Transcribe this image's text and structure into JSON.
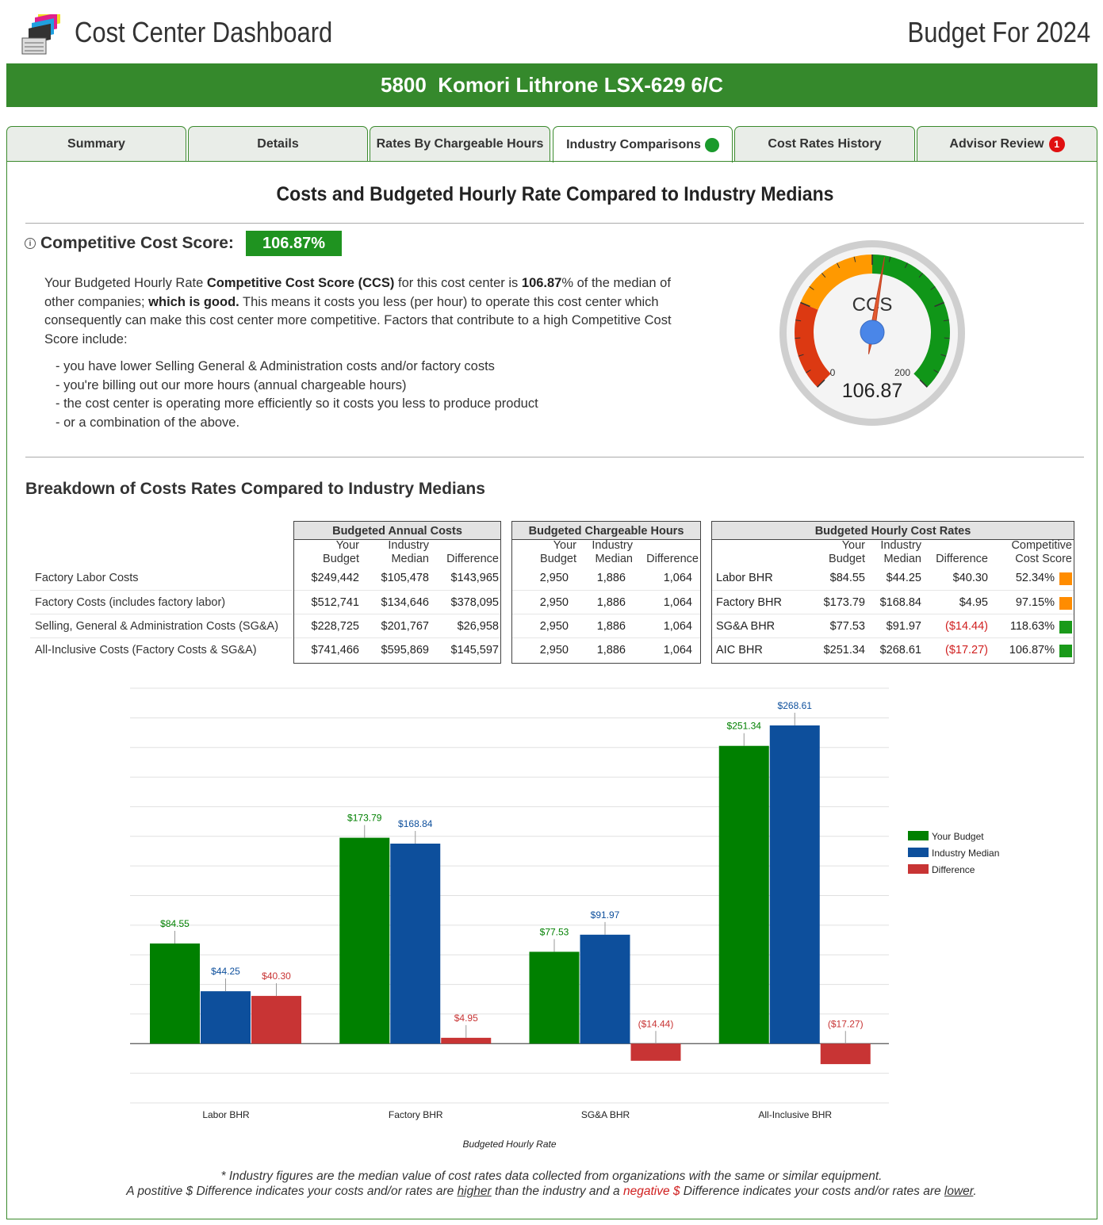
{
  "header": {
    "app_title": "Cost Center Dashboard",
    "budget_label": "Budget For 2024",
    "cost_center": "5800  Komori Lithrone LSX-629 6/C"
  },
  "tabs": [
    {
      "label": "Summary"
    },
    {
      "label": "Details"
    },
    {
      "label": "Rates By Chargeable Hours"
    },
    {
      "label": "Industry Comparisons",
      "indicator": "green-dot"
    },
    {
      "label": "Cost Rates History"
    },
    {
      "label": "Advisor Review",
      "badge": "1"
    }
  ],
  "colors": {
    "brand_green": "#35892c",
    "score_green": "#1f9320",
    "bar_green": "#008000",
    "bar_blue": "#0d4f9c",
    "bar_red": "#c83434",
    "negative_red": "#d02020",
    "orange": "#ff8c00"
  },
  "comparison": {
    "heading": "Costs and Budgeted Hourly Rate Compared to Industry Medians",
    "score_label": "Competitive Cost Score:",
    "score_value": "106.87%",
    "para": {
      "t1": "Your Budgeted Hourly Rate ",
      "b1": "Competitive Cost Score (CCS)",
      "t2": " for this cost center is ",
      "b2": "106.87",
      "t3": "% of the median of other companies; ",
      "b3": "which is good.",
      "t4": " This means it costs you less (per hour) to operate this cost center which consequently can make this cost center more competitive. Factors that contribute to a high Competitive Cost Score include:"
    },
    "bullets": [
      "- you have lower Selling General & Administration costs and/or factory costs",
      "- you're billing out our more hours (annual chargeable hours)",
      "- the cost center is operating more efficiently so it costs you less to produce product",
      "- or a combination of the above."
    ]
  },
  "gauge": {
    "label": "CCS",
    "min": "0",
    "max": "200",
    "value": 106.87,
    "value_text": "106.87"
  },
  "breakdown": {
    "heading": "Breakdown of Costs Rates Compared to Industry Medians",
    "annual": {
      "title": "Budgeted Annual Costs",
      "cols": [
        [
          "Your",
          "Budget"
        ],
        [
          "Industry",
          "Median"
        ],
        [
          "",
          "Difference"
        ]
      ],
      "rows": [
        {
          "label": "Factory Labor Costs",
          "values": [
            "$249,442",
            "$105,478",
            "$143,965"
          ]
        },
        {
          "label": "Factory Costs (includes factory labor)",
          "values": [
            "$512,741",
            "$134,646",
            "$378,095"
          ]
        },
        {
          "label": "Selling, General & Administration Costs (SG&A)",
          "values": [
            "$228,725",
            "$201,767",
            "$26,958"
          ]
        },
        {
          "label": "All-Inclusive Costs (Factory Costs & SG&A)",
          "values": [
            "$741,466",
            "$595,869",
            "$145,597"
          ]
        }
      ]
    },
    "hours": {
      "title": "Budgeted Chargeable Hours",
      "cols": [
        [
          "Your",
          "Budget"
        ],
        [
          "Industry",
          "Median"
        ],
        [
          "",
          "Difference"
        ]
      ],
      "rows": [
        [
          "2,950",
          "1,886",
          "1,064"
        ],
        [
          "2,950",
          "1,886",
          "1,064"
        ],
        [
          "2,950",
          "1,886",
          "1,064"
        ],
        [
          "2,950",
          "1,886",
          "1,064"
        ]
      ]
    },
    "rates": {
      "title": "Budgeted Hourly Cost Rates",
      "cols": [
        [
          "Your",
          "Budget"
        ],
        [
          "Industry",
          "Median"
        ],
        [
          "",
          "Difference"
        ],
        [
          "Competitive",
          "Cost Score"
        ]
      ],
      "rows": [
        {
          "label": "Labor BHR",
          "values": [
            "$84.55",
            "$44.25",
            "$40.30",
            "52.34%"
          ],
          "negative": false,
          "color": "#ff8c00"
        },
        {
          "label": "Factory BHR",
          "values": [
            "$173.79",
            "$168.84",
            "$4.95",
            "97.15%"
          ],
          "negative": false,
          "color": "#ff8c00"
        },
        {
          "label": "SG&A BHR",
          "values": [
            "$77.53",
            "$91.97",
            "($14.44)",
            "118.63%"
          ],
          "negative": true,
          "color": "#1a9a1a"
        },
        {
          "label": "AIC BHR",
          "values": [
            "$251.34",
            "$268.61",
            "($17.27)",
            "106.87%"
          ],
          "negative": true,
          "color": "#1a9a1a"
        }
      ]
    }
  },
  "chart_data": {
    "type": "bar",
    "categories": [
      "Labor BHR",
      "Factory BHR",
      "SG&A BHR",
      "All-Inclusive BHR"
    ],
    "series": [
      {
        "name": "Your Budget",
        "values": [
          84.55,
          173.79,
          77.53,
          251.34
        ],
        "labels": [
          "$84.55",
          "$173.79",
          "$77.53",
          "$251.34"
        ],
        "color": "#008000"
      },
      {
        "name": "Industry Median",
        "values": [
          44.25,
          168.84,
          91.97,
          268.61
        ],
        "labels": [
          "$44.25",
          "$168.84",
          "$91.97",
          "$268.61"
        ],
        "color": "#0d4f9c"
      },
      {
        "name": "Difference",
        "values": [
          40.3,
          4.95,
          -14.44,
          -17.27
        ],
        "labels": [
          "$40.30",
          "$4.95",
          "($14.44)",
          "($17.27)"
        ],
        "color": "#c83434"
      }
    ],
    "xlabel": "Budgeted Hourly Rate",
    "ylabel": "",
    "ylim": [
      -50,
      300
    ],
    "grid": true,
    "legend": "right"
  },
  "footnote": {
    "line1": "* Industry figures are the median value of cost rates data collected from organizations with the same or similar equipment.",
    "l2a": "A postitive $ Difference indicates your costs and/or rates are ",
    "l2b": "higher",
    "l2c": " than the industry and a ",
    "l2d": "negative $",
    "l2e": " Difference indicates your costs and/or rates are ",
    "l2f": "lower",
    "l2g": "."
  }
}
